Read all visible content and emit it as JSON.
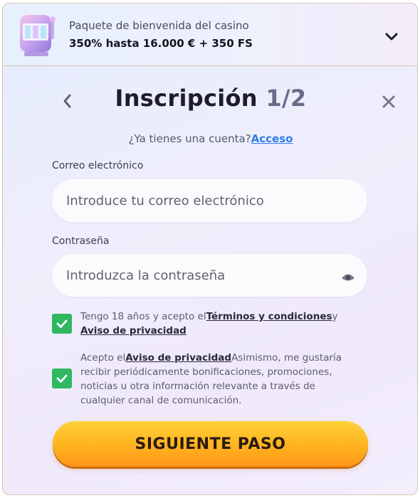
{
  "bonus": {
    "subtitle": "Paquete de bienvenida del casino",
    "title": "350% hasta 16.000 € + 350 FS"
  },
  "header": {
    "title": "Inscripción",
    "step": "1/2"
  },
  "login_prompt": {
    "text": "¿Ya tienes una cuenta?",
    "link": "Acceso"
  },
  "email": {
    "label": "Correo electrónico",
    "placeholder": "Introduce tu correo electrónico"
  },
  "password": {
    "label": "Contraseña",
    "placeholder": "Introduzca la contraseña"
  },
  "consent1": {
    "pre": "Tengo 18 años y acepto el",
    "terms_link": "Términos y condiciones",
    "mid": "y",
    "privacy_link": "Aviso de privacidad",
    "checked": true
  },
  "consent2": {
    "pre": "Acepto el",
    "privacy_link": "Aviso de privacidad",
    "post": "Asimismo, me gustaría recibir periódicamente bonificaciones, promociones, noticias u otra información relevante a través de cualquier canal de comunicación.",
    "checked": true
  },
  "submit_label": "SIGUIENTE PASO",
  "colors": {
    "accent_link": "#2f7de9",
    "checkbox": "#2fb85f",
    "cta_top": "#ffd23a",
    "cta_bottom": "#ff951a"
  },
  "icons": {
    "slot": "slot-machine-icon",
    "chevron": "chevron-down-icon",
    "back": "chevron-left-icon",
    "close": "close-icon",
    "eye": "eye-icon",
    "check": "checkmark-icon"
  }
}
